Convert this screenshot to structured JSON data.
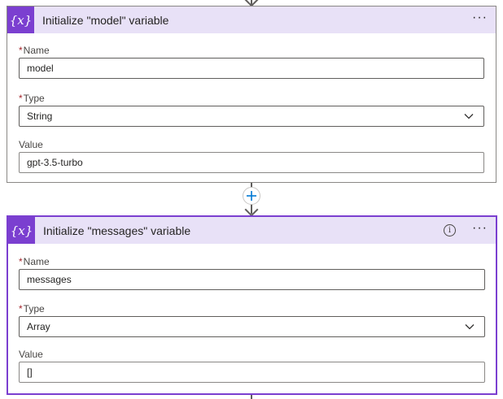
{
  "steps": [
    {
      "title": "Initialize \"model\" variable",
      "icon": "variable-icon",
      "icon_glyph": "{x}",
      "fields": {
        "name_label": "Name",
        "name_value": "model",
        "type_label": "Type",
        "type_value": "String",
        "value_label": "Value",
        "value_value": "gpt-3.5-turbo"
      }
    },
    {
      "title": "Initialize \"messages\" variable",
      "icon": "variable-icon",
      "icon_glyph": "{x}",
      "fields": {
        "name_label": "Name",
        "name_value": "messages",
        "type_label": "Type",
        "type_value": "Array",
        "value_label": "Value",
        "value_value": "[]"
      }
    }
  ],
  "required_marker": "*",
  "colors": {
    "accent": "#7b3fd0",
    "header_bg": "#e8e1f7",
    "required": "#a4262c",
    "add_button": "#0078d4"
  }
}
